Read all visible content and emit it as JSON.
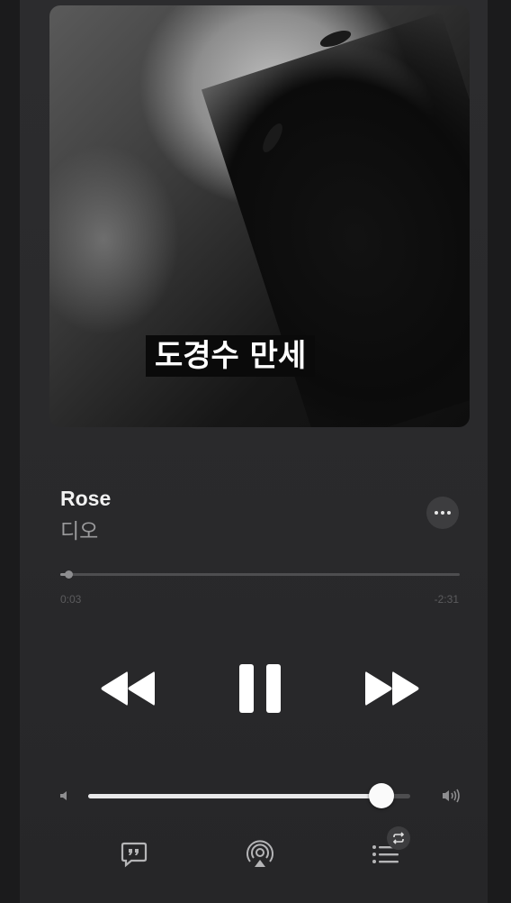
{
  "artwork": {
    "caption": "도경수 만세"
  },
  "track": {
    "title": "Rose",
    "artist": "디오"
  },
  "progress": {
    "elapsed": "0:03",
    "remaining": "-2:31",
    "fraction": 0.02
  },
  "volume": {
    "level": 0.91
  },
  "controls": {
    "more": "ellipsis-icon",
    "rewind": "rewind-icon",
    "pause": "pause-icon",
    "forward": "fast-forward-icon",
    "volume_low": "speaker-low-icon",
    "volume_high": "speaker-high-icon",
    "lyrics": "lyrics-quote-icon",
    "airplay": "airplay-icon",
    "queue": "queue-list-icon",
    "repeat": "repeat-icon"
  },
  "colors": {
    "background": "#1b1b1c",
    "panel": "#2b2b2d",
    "accent": "#ffffff",
    "secondary_text": "#9a9a9c"
  }
}
